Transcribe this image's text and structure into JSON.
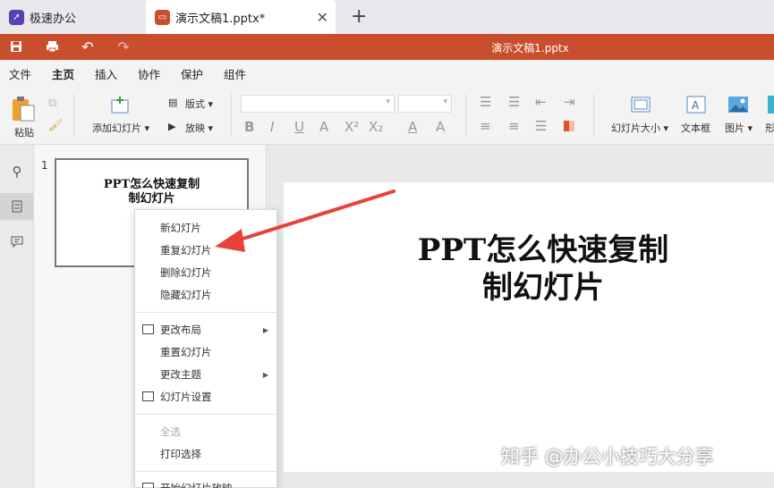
{
  "tabs": {
    "home": "极速办公",
    "doc": "演示文稿1.pptx*"
  },
  "title": "演示文稿1.pptx",
  "menu": [
    "文件",
    "主页",
    "插入",
    "协作",
    "保护",
    "组件"
  ],
  "ribbon": {
    "paste": "粘贴",
    "add_slide": "添加幻灯片",
    "layout": "版式",
    "play": "放映",
    "slide_size": "幻灯片大小",
    "textbox": "文本框",
    "picture": "图片",
    "shape": "形"
  },
  "thumbnail": {
    "number": "1",
    "title": "PPT怎么快速复制\n制幻灯片"
  },
  "slide": {
    "title": "PPT怎么快速复制\n制幻灯片"
  },
  "context_menu": {
    "new_slide": "新幻灯片",
    "duplicate_slide": "重复幻灯片",
    "delete_slide": "删除幻灯片",
    "hide_slide": "隐藏幻灯片",
    "change_layout": "更改布局",
    "reset_slide": "重置幻灯片",
    "change_theme": "更改主题",
    "slide_settings": "幻灯片设置",
    "select_all": "全选",
    "print_selection": "打印选择",
    "start_slideshow": "开始幻灯片放映"
  },
  "watermark": "知乎 @办公小技巧大分享",
  "colors": {
    "accent": "#c84e2d",
    "arrow": "#e8413c"
  }
}
